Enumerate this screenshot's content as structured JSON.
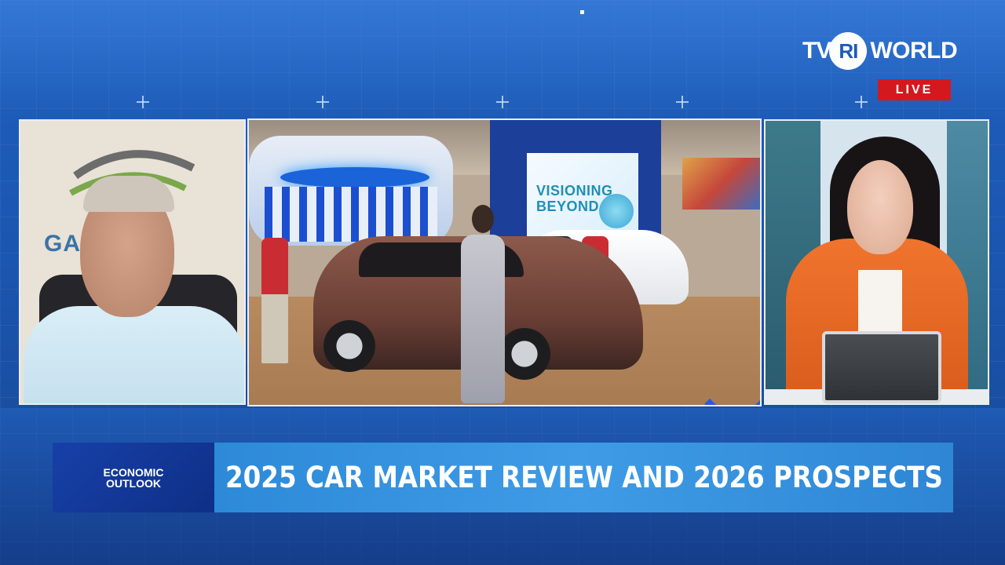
{
  "broadcast": {
    "logo": {
      "part1": "TV",
      "part2": "RI",
      "part3": "WORLD"
    },
    "live_badge": "LIVE",
    "brand_color": "#1d5bb8",
    "live_color": "#d3191e"
  },
  "panels": {
    "guest": {
      "backdrop_logo_text": "GA      O"
    },
    "venue": {
      "screen_text_line1": "VISIONING",
      "screen_text_line2": "BEYOND"
    },
    "host": {}
  },
  "lower_third": {
    "program_line1": "ECONOMIC",
    "program_line2": "OUTLOOK",
    "headline": "2025 CAR MARKET REVIEW AND 2026 PROSPECTS"
  }
}
